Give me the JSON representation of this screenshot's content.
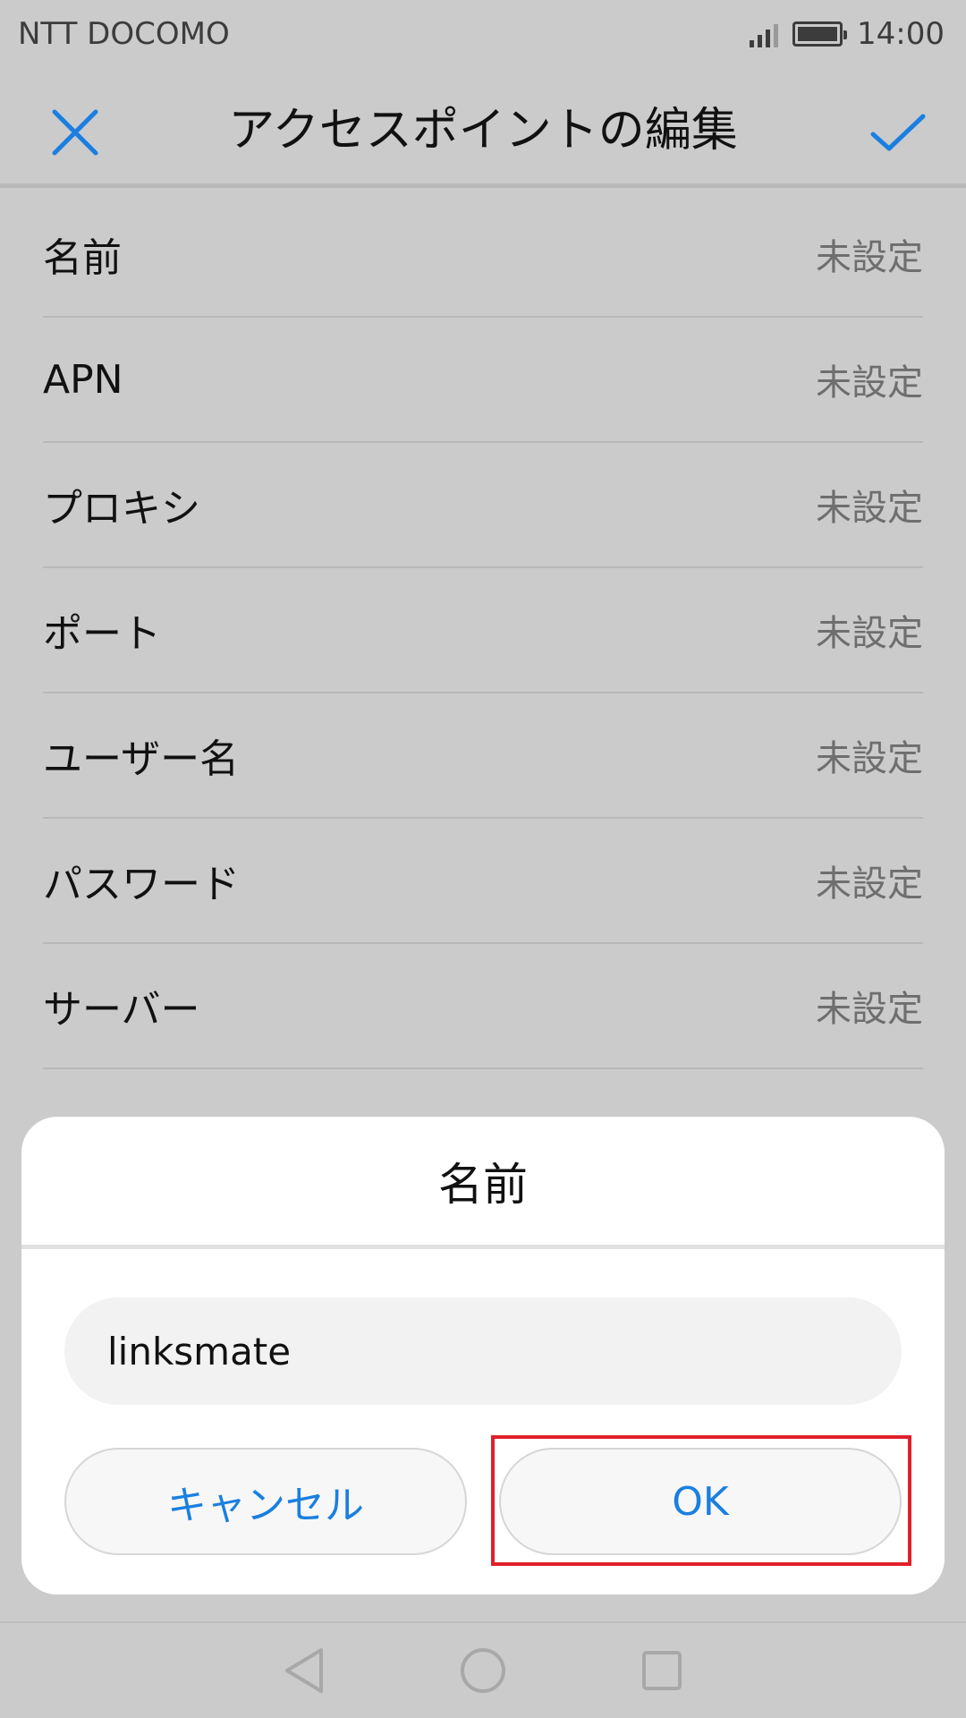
{
  "status_bar": {
    "carrier": "NTT DOCOMO",
    "time": "14:00"
  },
  "app_bar": {
    "title": "アクセスポイントの編集"
  },
  "apn_fields": [
    {
      "label": "名前",
      "value": "未設定"
    },
    {
      "label": "APN",
      "value": "未設定"
    },
    {
      "label": "プロキシ",
      "value": "未設定"
    },
    {
      "label": "ポート",
      "value": "未設定"
    },
    {
      "label": "ユーザー名",
      "value": "未設定"
    },
    {
      "label": "パスワード",
      "value": "未設定"
    },
    {
      "label": "サーバー",
      "value": "未設定"
    }
  ],
  "dialog": {
    "title": "名前",
    "input_value": "linksmate",
    "cancel_label": "キャンセル",
    "ok_label": "OK"
  },
  "colors": {
    "accent": "#1a7fe0",
    "highlight": "#e0202a",
    "background": "#cbcbcb"
  },
  "icons": {
    "close": "close-icon",
    "confirm": "check-icon",
    "back": "back-icon",
    "home": "home-icon",
    "recents": "recents-icon"
  }
}
